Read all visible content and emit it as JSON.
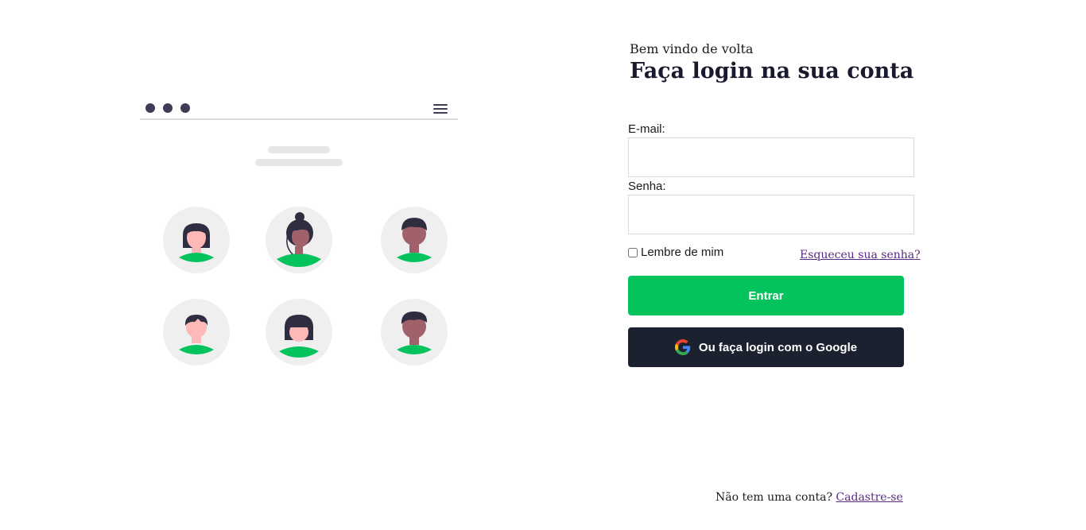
{
  "illustration": {
    "avatars": [
      {
        "name": "avatar-woman-bob",
        "hair": "bob",
        "skin": "#ffb8b8"
      },
      {
        "name": "avatar-woman-bun",
        "hair": "bun",
        "skin": "#a0616a"
      },
      {
        "name": "avatar-man-short",
        "hair": "short",
        "skin": "#a0616a"
      },
      {
        "name": "avatar-man-parted",
        "hair": "parted",
        "skin": "#ffb8b8"
      },
      {
        "name": "avatar-woman-bangs",
        "hair": "bangs",
        "skin": "#ffb8b8"
      },
      {
        "name": "avatar-man-side",
        "hair": "side",
        "skin": "#a0616a"
      }
    ],
    "colors": {
      "dark": "#3f3d56",
      "green": "#04c35c",
      "circle": "#efefef",
      "hair": "#2f2e41"
    }
  },
  "login": {
    "welcome": "Bem vindo de volta",
    "heading": "Faça login na sua conta",
    "email_label": "E-mail:",
    "email_value": "",
    "password_label": "Senha:",
    "password_value": "",
    "remember_label": "Lembre de mim",
    "forgot_link": "Esqueceu sua senha?",
    "submit_label": "Entrar",
    "google_label": "Ou faça login com o Google",
    "no_account_text": "Não tem uma conta?",
    "signup_link": "Cadastre-se"
  },
  "colors": {
    "accent": "#04c35c",
    "google_button": "#1c2130",
    "link": "#5b2a86"
  }
}
